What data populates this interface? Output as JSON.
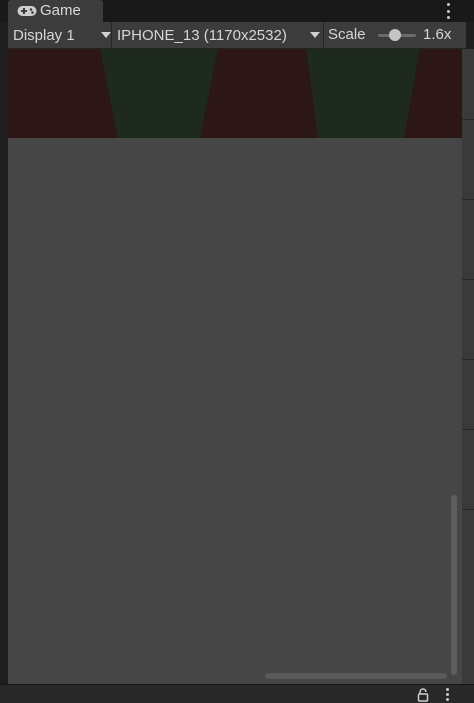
{
  "tab": {
    "label": "Game",
    "icon": "gamepad-icon"
  },
  "toolbar": {
    "display": {
      "label": "Display 1",
      "icon": "caret-down-icon"
    },
    "resolution": {
      "label": "IPHONE_13 (1170x2532)",
      "icon": "caret-down-icon"
    },
    "scale": {
      "label": "Scale",
      "value": "1.6x",
      "slider_fraction": 0.4
    }
  },
  "colors": {
    "panel": "#3c3c3c",
    "view_background": "#464646",
    "game_dark_red": "#2a1414",
    "game_dark_green": "#1e2b1e"
  },
  "icons": {
    "menu": "kebab-menu-icon",
    "lock": "lock-icon"
  }
}
